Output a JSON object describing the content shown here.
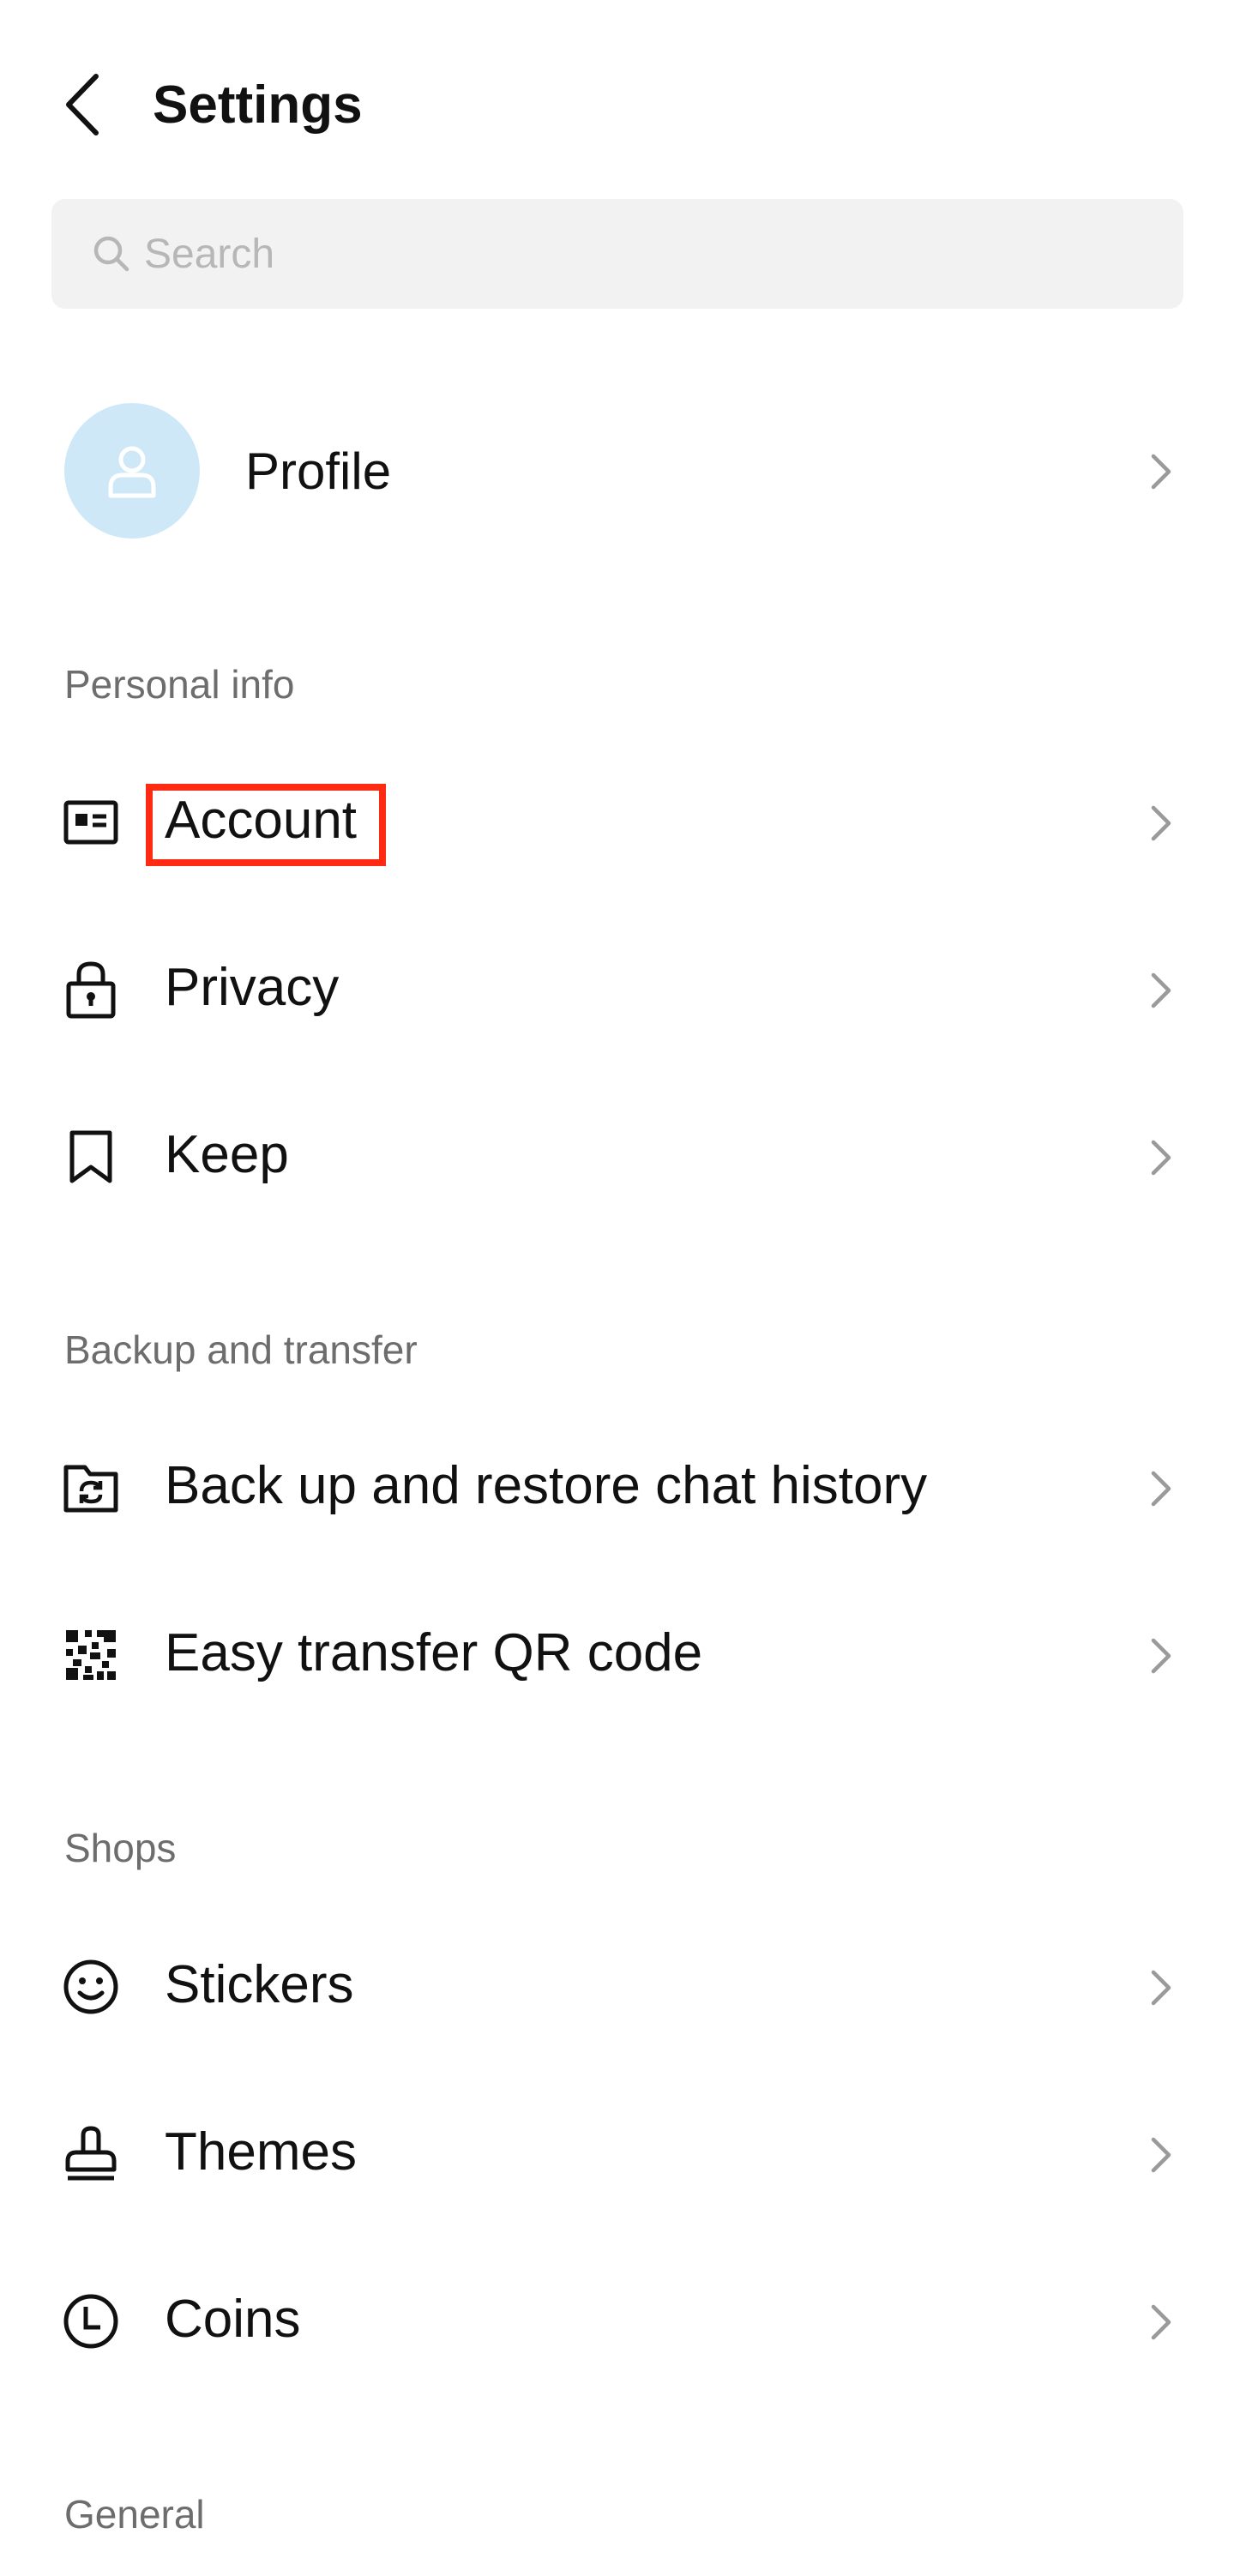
{
  "header": {
    "title": "Settings",
    "back_icon": "chevron-left-icon"
  },
  "search": {
    "placeholder": "Search",
    "icon": "search-icon"
  },
  "profile": {
    "label": "Profile",
    "avatar_icon": "person-icon",
    "avatar_color": "#cfe8f7"
  },
  "sections": {
    "personal_info": {
      "title": "Personal info",
      "items": [
        {
          "label": "Account",
          "icon": "id-card-icon"
        },
        {
          "label": "Privacy",
          "icon": "lock-icon"
        },
        {
          "label": "Keep",
          "icon": "bookmark-icon"
        }
      ]
    },
    "backup_and_transfer": {
      "title": "Backup and transfer",
      "items": [
        {
          "label": "Back up and restore chat history",
          "icon": "folder-sync-icon"
        },
        {
          "label": "Easy transfer QR code",
          "icon": "qr-code-icon"
        }
      ]
    },
    "shops": {
      "title": "Shops",
      "items": [
        {
          "label": "Stickers",
          "icon": "smiley-icon"
        },
        {
          "label": "Themes",
          "icon": "stamp-icon"
        },
        {
          "label": "Coins",
          "icon": "clock-coin-icon"
        }
      ]
    },
    "general": {
      "title": "General"
    }
  },
  "colors": {
    "highlight": "#ff2a12",
    "section_header": "#6d6d6d",
    "chevron": "#9a9a9a"
  }
}
